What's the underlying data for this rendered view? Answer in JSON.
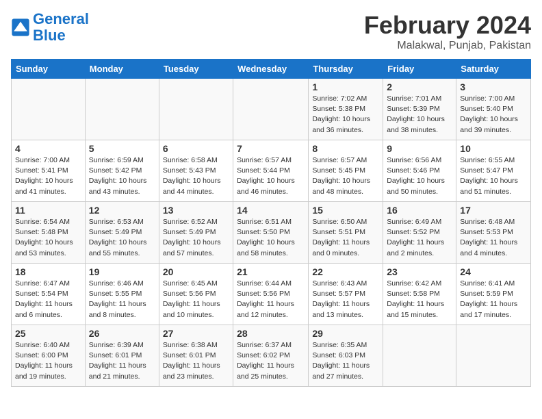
{
  "header": {
    "logo_line1": "General",
    "logo_line2": "Blue",
    "month": "February 2024",
    "location": "Malakwal, Punjab, Pakistan"
  },
  "weekdays": [
    "Sunday",
    "Monday",
    "Tuesday",
    "Wednesday",
    "Thursday",
    "Friday",
    "Saturday"
  ],
  "weeks": [
    [
      {
        "day": "",
        "info": ""
      },
      {
        "day": "",
        "info": ""
      },
      {
        "day": "",
        "info": ""
      },
      {
        "day": "",
        "info": ""
      },
      {
        "day": "1",
        "info": "Sunrise: 7:02 AM\nSunset: 5:38 PM\nDaylight: 10 hours\nand 36 minutes."
      },
      {
        "day": "2",
        "info": "Sunrise: 7:01 AM\nSunset: 5:39 PM\nDaylight: 10 hours\nand 38 minutes."
      },
      {
        "day": "3",
        "info": "Sunrise: 7:00 AM\nSunset: 5:40 PM\nDaylight: 10 hours\nand 39 minutes."
      }
    ],
    [
      {
        "day": "4",
        "info": "Sunrise: 7:00 AM\nSunset: 5:41 PM\nDaylight: 10 hours\nand 41 minutes."
      },
      {
        "day": "5",
        "info": "Sunrise: 6:59 AM\nSunset: 5:42 PM\nDaylight: 10 hours\nand 43 minutes."
      },
      {
        "day": "6",
        "info": "Sunrise: 6:58 AM\nSunset: 5:43 PM\nDaylight: 10 hours\nand 44 minutes."
      },
      {
        "day": "7",
        "info": "Sunrise: 6:57 AM\nSunset: 5:44 PM\nDaylight: 10 hours\nand 46 minutes."
      },
      {
        "day": "8",
        "info": "Sunrise: 6:57 AM\nSunset: 5:45 PM\nDaylight: 10 hours\nand 48 minutes."
      },
      {
        "day": "9",
        "info": "Sunrise: 6:56 AM\nSunset: 5:46 PM\nDaylight: 10 hours\nand 50 minutes."
      },
      {
        "day": "10",
        "info": "Sunrise: 6:55 AM\nSunset: 5:47 PM\nDaylight: 10 hours\nand 51 minutes."
      }
    ],
    [
      {
        "day": "11",
        "info": "Sunrise: 6:54 AM\nSunset: 5:48 PM\nDaylight: 10 hours\nand 53 minutes."
      },
      {
        "day": "12",
        "info": "Sunrise: 6:53 AM\nSunset: 5:49 PM\nDaylight: 10 hours\nand 55 minutes."
      },
      {
        "day": "13",
        "info": "Sunrise: 6:52 AM\nSunset: 5:49 PM\nDaylight: 10 hours\nand 57 minutes."
      },
      {
        "day": "14",
        "info": "Sunrise: 6:51 AM\nSunset: 5:50 PM\nDaylight: 10 hours\nand 58 minutes."
      },
      {
        "day": "15",
        "info": "Sunrise: 6:50 AM\nSunset: 5:51 PM\nDaylight: 11 hours\nand 0 minutes."
      },
      {
        "day": "16",
        "info": "Sunrise: 6:49 AM\nSunset: 5:52 PM\nDaylight: 11 hours\nand 2 minutes."
      },
      {
        "day": "17",
        "info": "Sunrise: 6:48 AM\nSunset: 5:53 PM\nDaylight: 11 hours\nand 4 minutes."
      }
    ],
    [
      {
        "day": "18",
        "info": "Sunrise: 6:47 AM\nSunset: 5:54 PM\nDaylight: 11 hours\nand 6 minutes."
      },
      {
        "day": "19",
        "info": "Sunrise: 6:46 AM\nSunset: 5:55 PM\nDaylight: 11 hours\nand 8 minutes."
      },
      {
        "day": "20",
        "info": "Sunrise: 6:45 AM\nSunset: 5:56 PM\nDaylight: 11 hours\nand 10 minutes."
      },
      {
        "day": "21",
        "info": "Sunrise: 6:44 AM\nSunset: 5:56 PM\nDaylight: 11 hours\nand 12 minutes."
      },
      {
        "day": "22",
        "info": "Sunrise: 6:43 AM\nSunset: 5:57 PM\nDaylight: 11 hours\nand 13 minutes."
      },
      {
        "day": "23",
        "info": "Sunrise: 6:42 AM\nSunset: 5:58 PM\nDaylight: 11 hours\nand 15 minutes."
      },
      {
        "day": "24",
        "info": "Sunrise: 6:41 AM\nSunset: 5:59 PM\nDaylight: 11 hours\nand 17 minutes."
      }
    ],
    [
      {
        "day": "25",
        "info": "Sunrise: 6:40 AM\nSunset: 6:00 PM\nDaylight: 11 hours\nand 19 minutes."
      },
      {
        "day": "26",
        "info": "Sunrise: 6:39 AM\nSunset: 6:01 PM\nDaylight: 11 hours\nand 21 minutes."
      },
      {
        "day": "27",
        "info": "Sunrise: 6:38 AM\nSunset: 6:01 PM\nDaylight: 11 hours\nand 23 minutes."
      },
      {
        "day": "28",
        "info": "Sunrise: 6:37 AM\nSunset: 6:02 PM\nDaylight: 11 hours\nand 25 minutes."
      },
      {
        "day": "29",
        "info": "Sunrise: 6:35 AM\nSunset: 6:03 PM\nDaylight: 11 hours\nand 27 minutes."
      },
      {
        "day": "",
        "info": ""
      },
      {
        "day": "",
        "info": ""
      }
    ]
  ]
}
